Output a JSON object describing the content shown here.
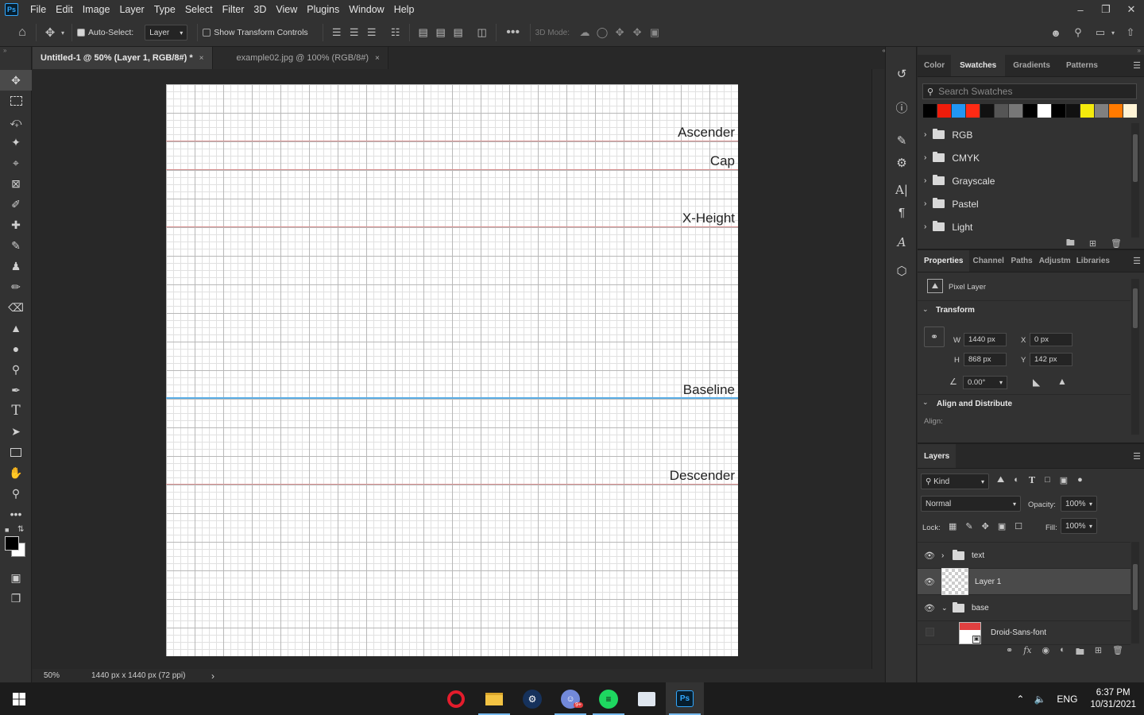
{
  "app": {
    "logo": "Ps"
  },
  "menu": [
    "File",
    "Edit",
    "Image",
    "Layer",
    "Type",
    "Select",
    "Filter",
    "3D",
    "View",
    "Plugins",
    "Window",
    "Help"
  ],
  "options": {
    "auto_select_label": "Auto-Select:",
    "auto_select_value": "Layer",
    "show_transform_label": "Show Transform Controls",
    "mode_3d_label": "3D Mode:"
  },
  "tabs": [
    {
      "label": "Untitled-1 @ 50% (Layer 1, RGB/8#) *",
      "close": "×"
    },
    {
      "label": "example02.jpg @ 100% (RGB/8#)",
      "close": "×"
    }
  ],
  "canvas": {
    "guides": [
      {
        "label": "Ascender",
        "color": "#d89090"
      },
      {
        "label": "Cap",
        "color": "#d89090"
      },
      {
        "label": "X-Height",
        "color": "#d89090"
      },
      {
        "label": "Baseline",
        "color": "#5aaee6"
      },
      {
        "label": "Descender",
        "color": "#d89090"
      }
    ]
  },
  "status": {
    "zoom": "50%",
    "doc_info": "1440 px x 1440 px (72 ppi)",
    "arrow": "›"
  },
  "swatches_panel": {
    "tabs": [
      "Color",
      "Swatches",
      "Gradients",
      "Patterns"
    ],
    "search_placeholder": "Search Swatches",
    "colors": [
      "#000000",
      "#ee1c0b",
      "#2196f3",
      "#ff2a14",
      "#111111",
      "#555555",
      "#777777",
      "#000000",
      "#ffffff",
      "#000000",
      "#111111",
      "#f4ea0c",
      "#808080",
      "#ff7a00",
      "#fff4d6"
    ],
    "groups": [
      "RGB",
      "CMYK",
      "Grayscale",
      "Pastel",
      "Light"
    ]
  },
  "properties_panel": {
    "tabs": [
      "Properties",
      "Channel",
      "Paths",
      "Adjustm",
      "Libraries"
    ],
    "kind": "Pixel Layer",
    "transform_title": "Transform",
    "w_label": "W",
    "w": "1440 px",
    "h_label": "H",
    "h": "868 px",
    "x_label": "X",
    "x": "0 px",
    "y_label": "Y",
    "y": "142 px",
    "angle": "0.00°",
    "align_title": "Align and Distribute",
    "align_label": "Align:"
  },
  "layers_panel": {
    "tab": "Layers",
    "filter": "Kind",
    "blend_mode": "Normal",
    "opacity_label": "Opacity:",
    "opacity": "100%",
    "lock_label": "Lock:",
    "fill_label": "Fill:",
    "fill": "100%",
    "layers": [
      {
        "name": "text",
        "type": "group",
        "visible": true
      },
      {
        "name": "Layer 1",
        "type": "pixel",
        "visible": true,
        "selected": true
      },
      {
        "name": "base",
        "type": "group",
        "visible": true
      },
      {
        "name": "Droid-Sans-font",
        "type": "smart",
        "visible": false
      }
    ]
  },
  "taskbar": {
    "language": "ENG",
    "time": "6:37 PM",
    "date": "10/31/2021",
    "apps": [
      "opera-icon",
      "file-explorer-icon",
      "steam-icon",
      "discord-icon",
      "spotify-icon",
      "app-icon",
      "photoshop-icon"
    ],
    "discord_badge": "9+"
  }
}
